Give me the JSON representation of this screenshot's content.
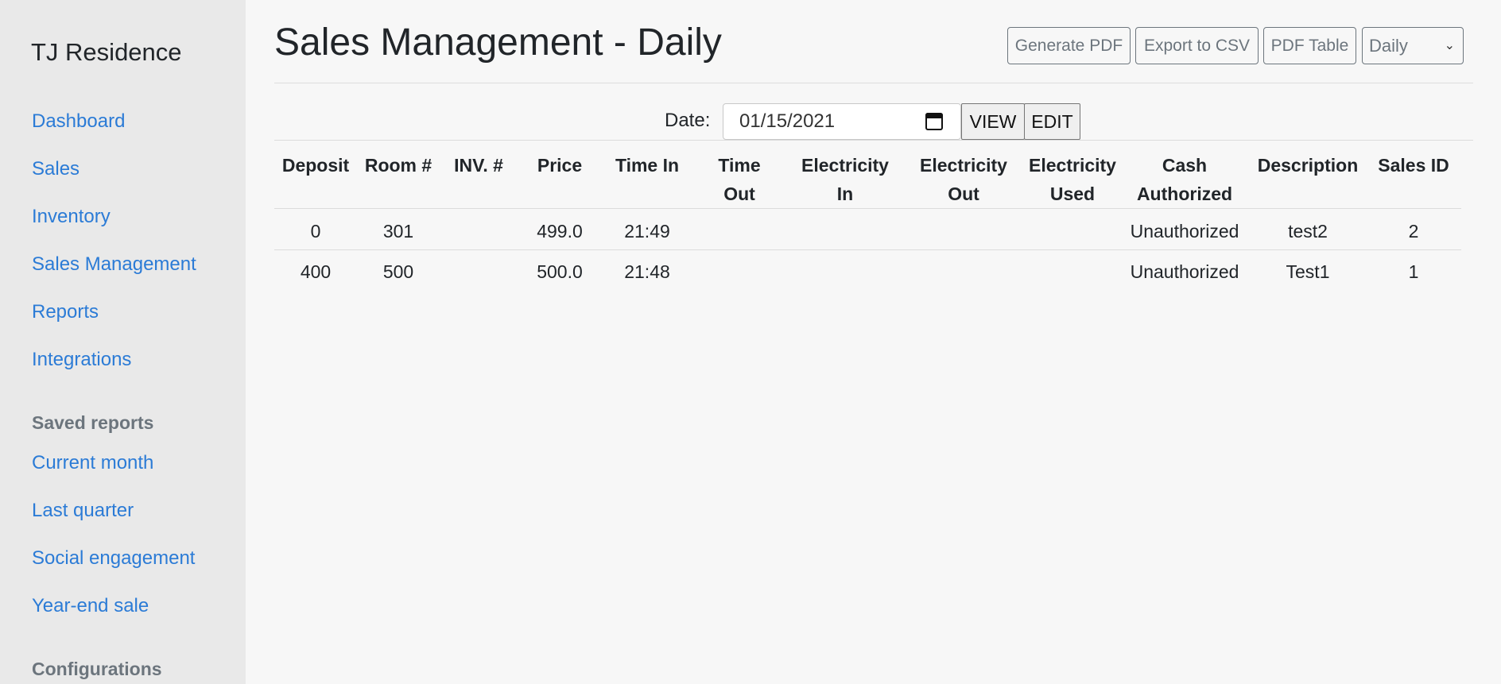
{
  "sidebar": {
    "brand": "TJ Residence",
    "nav": [
      "Dashboard",
      "Sales",
      "Inventory",
      "Sales Management",
      "Reports",
      "Integrations"
    ],
    "saved_heading": "Saved reports",
    "saved": [
      "Current month",
      "Last quarter",
      "Social engagement",
      "Year-end sale"
    ],
    "config_heading": "Configurations"
  },
  "header": {
    "title": "Sales Management - Daily",
    "generate_pdf": "Generate PDF",
    "export_csv": "Export to CSV",
    "pdf_table": "PDF Table",
    "period_select": "Daily"
  },
  "filter": {
    "date_label": "Date:",
    "date_value": "01/15/2021",
    "view_label": "VIEW",
    "edit_label": "EDIT"
  },
  "table": {
    "columns": [
      [
        "Deposit",
        ""
      ],
      [
        "Room #",
        ""
      ],
      [
        "INV. #",
        ""
      ],
      [
        "Price",
        ""
      ],
      [
        "Time In",
        ""
      ],
      [
        "Time",
        "Out"
      ],
      [
        "Electricity",
        "In"
      ],
      [
        "Electricity",
        "Out"
      ],
      [
        "Electricity",
        "Used"
      ],
      [
        "Cash",
        "Authorized"
      ],
      [
        "Description",
        ""
      ],
      [
        "Sales ID",
        ""
      ]
    ],
    "rows": [
      [
        "0",
        "301",
        "",
        "499.0",
        "21:49",
        "",
        "",
        "",
        "",
        "Unauthorized",
        "test2",
        "2"
      ],
      [
        "400",
        "500",
        "",
        "500.0",
        "21:48",
        "",
        "",
        "",
        "",
        "Unauthorized",
        "Test1",
        "1"
      ]
    ]
  },
  "colors": {
    "link": "#2b7bd6",
    "sidebar_bg": "#e9e9e9",
    "page_bg": "#f7f7f7"
  }
}
